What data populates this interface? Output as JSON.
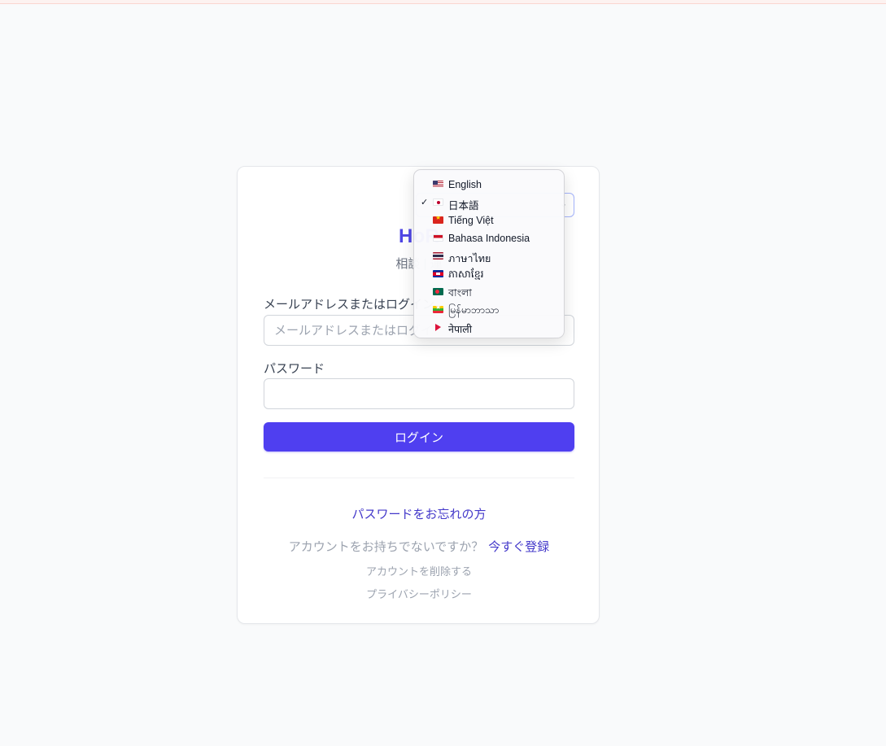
{
  "app": {
    "brand": "HoR",
    "subtitle": "相談 | 運"
  },
  "language_select": {
    "current": "日本語"
  },
  "form": {
    "email_label": "メールアドレスまたはログイン",
    "email_placeholder": "メールアドレスまたはログイ",
    "password_label": "パスワード",
    "login_button": "ログイン"
  },
  "links": {
    "forgot_password": "パスワードをお忘れの方",
    "no_account_text": "アカウントをお持ちでないですか？",
    "register_now": "今すぐ登録",
    "delete_account": "アカウントを削除する",
    "privacy_policy": "プライバシーポリシー"
  },
  "language_menu": {
    "items": [
      {
        "flag": "us-flag-icon",
        "label": "English",
        "checked": false
      },
      {
        "flag": "jp-flag-icon",
        "label": "日本語",
        "checked": true
      },
      {
        "flag": "vn-flag-icon",
        "label": "Tiếng Việt",
        "checked": false
      },
      {
        "flag": "id-flag-icon",
        "label": "Bahasa Indonesia",
        "checked": false
      },
      {
        "flag": "th-flag-icon",
        "label": "ภาษาไทย",
        "checked": false
      },
      {
        "flag": "kh-flag-icon",
        "label": "ភាសាខ្មែរ",
        "checked": false
      },
      {
        "flag": "bd-flag-icon",
        "label": "বাংলা",
        "checked": false
      },
      {
        "flag": "mm-flag-icon",
        "label": "မြန်မာဘာသာ",
        "checked": false
      },
      {
        "flag": "np-flag-icon",
        "label": "नेपाली",
        "checked": false
      }
    ],
    "check_mark": "✓"
  },
  "colors": {
    "accent": "#4f3ff0",
    "brand": "#4f46e5",
    "link": "#4338ca",
    "background": "#f9fafb"
  }
}
